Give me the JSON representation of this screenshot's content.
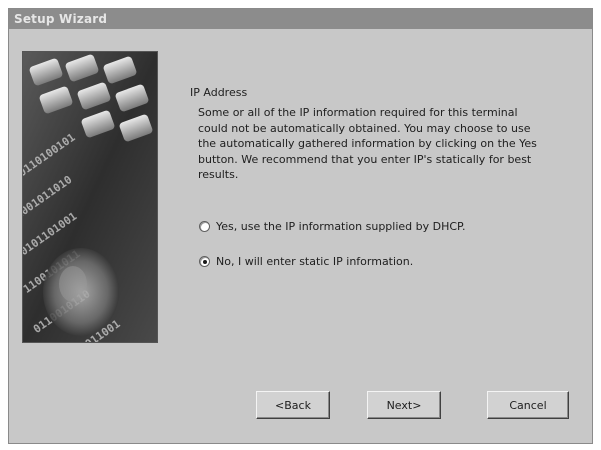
{
  "window": {
    "title": "Setup Wizard"
  },
  "main": {
    "heading": "IP Address",
    "description": "Some or all of the IP information required for this terminal could not be automatically obtained. You may choose to use the automatically gathered information by clicking on the Yes button.  We recommend that you enter IP's statically for best results.",
    "options": [
      {
        "label": "Yes, use the IP information supplied by DHCP.",
        "selected": false
      },
      {
        "label": "No, I will enter static IP information.",
        "selected": true
      }
    ]
  },
  "buttons": {
    "back_label": "<Back",
    "next_label": "Next>",
    "cancel_label": "Cancel"
  },
  "colors": {
    "window_bg": "#c8c8c8",
    "titlebar_bg": "#8c8c8c",
    "titlebar_text": "#e6e6e6"
  },
  "icons": {
    "banner": "keyboard-binary-head-image"
  }
}
